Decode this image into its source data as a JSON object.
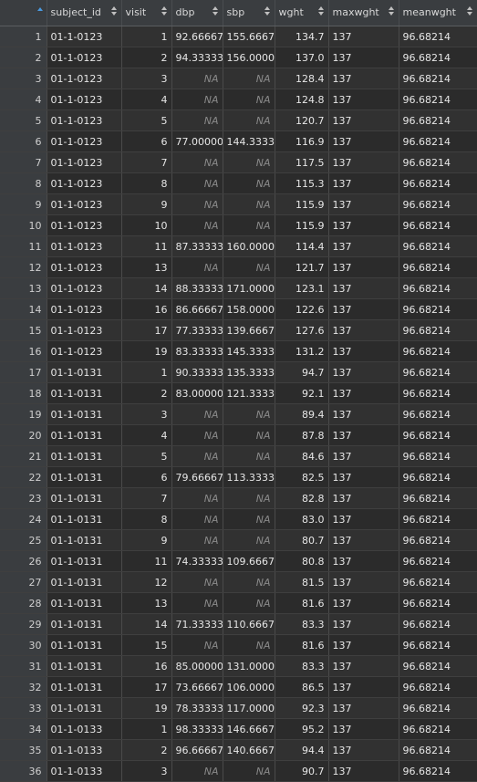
{
  "colors": {
    "background": "#2b2b2b",
    "header_bg": "#3a3d40",
    "text": "#e6e6e6",
    "na_text": "#8a8a8a",
    "sort_active": "#4a9ae0"
  },
  "columns": [
    {
      "key": "index",
      "label": ""
    },
    {
      "key": "subject_id",
      "label": "subject_id"
    },
    {
      "key": "visit",
      "label": "visit"
    },
    {
      "key": "dbp",
      "label": "dbp"
    },
    {
      "key": "sbp",
      "label": "sbp"
    },
    {
      "key": "wght",
      "label": "wght"
    },
    {
      "key": "maxwght",
      "label": "maxwght"
    },
    {
      "key": "meanwght",
      "label": "meanwght"
    }
  ],
  "na_label": "NA",
  "rows": [
    {
      "index": "1",
      "subject_id": "01-1-0123",
      "visit": "1",
      "dbp": "92.66667",
      "sbp": "155.6667",
      "wght": "134.7",
      "maxwght": "137",
      "meanwght": "96.68214"
    },
    {
      "index": "2",
      "subject_id": "01-1-0123",
      "visit": "2",
      "dbp": "94.33333",
      "sbp": "156.0000",
      "wght": "137.0",
      "maxwght": "137",
      "meanwght": "96.68214"
    },
    {
      "index": "3",
      "subject_id": "01-1-0123",
      "visit": "3",
      "dbp": "NA",
      "sbp": "NA",
      "wght": "128.4",
      "maxwght": "137",
      "meanwght": "96.68214"
    },
    {
      "index": "4",
      "subject_id": "01-1-0123",
      "visit": "4",
      "dbp": "NA",
      "sbp": "NA",
      "wght": "124.8",
      "maxwght": "137",
      "meanwght": "96.68214"
    },
    {
      "index": "5",
      "subject_id": "01-1-0123",
      "visit": "5",
      "dbp": "NA",
      "sbp": "NA",
      "wght": "120.7",
      "maxwght": "137",
      "meanwght": "96.68214"
    },
    {
      "index": "6",
      "subject_id": "01-1-0123",
      "visit": "6",
      "dbp": "77.00000",
      "sbp": "144.3333",
      "wght": "116.9",
      "maxwght": "137",
      "meanwght": "96.68214"
    },
    {
      "index": "7",
      "subject_id": "01-1-0123",
      "visit": "7",
      "dbp": "NA",
      "sbp": "NA",
      "wght": "117.5",
      "maxwght": "137",
      "meanwght": "96.68214"
    },
    {
      "index": "8",
      "subject_id": "01-1-0123",
      "visit": "8",
      "dbp": "NA",
      "sbp": "NA",
      "wght": "115.3",
      "maxwght": "137",
      "meanwght": "96.68214"
    },
    {
      "index": "9",
      "subject_id": "01-1-0123",
      "visit": "9",
      "dbp": "NA",
      "sbp": "NA",
      "wght": "115.9",
      "maxwght": "137",
      "meanwght": "96.68214"
    },
    {
      "index": "10",
      "subject_id": "01-1-0123",
      "visit": "10",
      "dbp": "NA",
      "sbp": "NA",
      "wght": "115.9",
      "maxwght": "137",
      "meanwght": "96.68214"
    },
    {
      "index": "11",
      "subject_id": "01-1-0123",
      "visit": "11",
      "dbp": "87.33333",
      "sbp": "160.0000",
      "wght": "114.4",
      "maxwght": "137",
      "meanwght": "96.68214"
    },
    {
      "index": "12",
      "subject_id": "01-1-0123",
      "visit": "13",
      "dbp": "NA",
      "sbp": "NA",
      "wght": "121.7",
      "maxwght": "137",
      "meanwght": "96.68214"
    },
    {
      "index": "13",
      "subject_id": "01-1-0123",
      "visit": "14",
      "dbp": "88.33333",
      "sbp": "171.0000",
      "wght": "123.1",
      "maxwght": "137",
      "meanwght": "96.68214"
    },
    {
      "index": "14",
      "subject_id": "01-1-0123",
      "visit": "16",
      "dbp": "86.66667",
      "sbp": "158.0000",
      "wght": "122.6",
      "maxwght": "137",
      "meanwght": "96.68214"
    },
    {
      "index": "15",
      "subject_id": "01-1-0123",
      "visit": "17",
      "dbp": "77.33333",
      "sbp": "139.6667",
      "wght": "127.6",
      "maxwght": "137",
      "meanwght": "96.68214"
    },
    {
      "index": "16",
      "subject_id": "01-1-0123",
      "visit": "19",
      "dbp": "83.33333",
      "sbp": "145.3333",
      "wght": "131.2",
      "maxwght": "137",
      "meanwght": "96.68214"
    },
    {
      "index": "17",
      "subject_id": "01-1-0131",
      "visit": "1",
      "dbp": "90.33333",
      "sbp": "135.3333",
      "wght": "94.7",
      "maxwght": "137",
      "meanwght": "96.68214"
    },
    {
      "index": "18",
      "subject_id": "01-1-0131",
      "visit": "2",
      "dbp": "83.00000",
      "sbp": "121.3333",
      "wght": "92.1",
      "maxwght": "137",
      "meanwght": "96.68214"
    },
    {
      "index": "19",
      "subject_id": "01-1-0131",
      "visit": "3",
      "dbp": "NA",
      "sbp": "NA",
      "wght": "89.4",
      "maxwght": "137",
      "meanwght": "96.68214"
    },
    {
      "index": "20",
      "subject_id": "01-1-0131",
      "visit": "4",
      "dbp": "NA",
      "sbp": "NA",
      "wght": "87.8",
      "maxwght": "137",
      "meanwght": "96.68214"
    },
    {
      "index": "21",
      "subject_id": "01-1-0131",
      "visit": "5",
      "dbp": "NA",
      "sbp": "NA",
      "wght": "84.6",
      "maxwght": "137",
      "meanwght": "96.68214"
    },
    {
      "index": "22",
      "subject_id": "01-1-0131",
      "visit": "6",
      "dbp": "79.66667",
      "sbp": "113.3333",
      "wght": "82.5",
      "maxwght": "137",
      "meanwght": "96.68214"
    },
    {
      "index": "23",
      "subject_id": "01-1-0131",
      "visit": "7",
      "dbp": "NA",
      "sbp": "NA",
      "wght": "82.8",
      "maxwght": "137",
      "meanwght": "96.68214"
    },
    {
      "index": "24",
      "subject_id": "01-1-0131",
      "visit": "8",
      "dbp": "NA",
      "sbp": "NA",
      "wght": "83.0",
      "maxwght": "137",
      "meanwght": "96.68214"
    },
    {
      "index": "25",
      "subject_id": "01-1-0131",
      "visit": "9",
      "dbp": "NA",
      "sbp": "NA",
      "wght": "80.7",
      "maxwght": "137",
      "meanwght": "96.68214"
    },
    {
      "index": "26",
      "subject_id": "01-1-0131",
      "visit": "11",
      "dbp": "74.33333",
      "sbp": "109.6667",
      "wght": "80.8",
      "maxwght": "137",
      "meanwght": "96.68214"
    },
    {
      "index": "27",
      "subject_id": "01-1-0131",
      "visit": "12",
      "dbp": "NA",
      "sbp": "NA",
      "wght": "81.5",
      "maxwght": "137",
      "meanwght": "96.68214"
    },
    {
      "index": "28",
      "subject_id": "01-1-0131",
      "visit": "13",
      "dbp": "NA",
      "sbp": "NA",
      "wght": "81.6",
      "maxwght": "137",
      "meanwght": "96.68214"
    },
    {
      "index": "29",
      "subject_id": "01-1-0131",
      "visit": "14",
      "dbp": "71.33333",
      "sbp": "110.6667",
      "wght": "83.3",
      "maxwght": "137",
      "meanwght": "96.68214"
    },
    {
      "index": "30",
      "subject_id": "01-1-0131",
      "visit": "15",
      "dbp": "NA",
      "sbp": "NA",
      "wght": "81.6",
      "maxwght": "137",
      "meanwght": "96.68214"
    },
    {
      "index": "31",
      "subject_id": "01-1-0131",
      "visit": "16",
      "dbp": "85.00000",
      "sbp": "131.0000",
      "wght": "83.3",
      "maxwght": "137",
      "meanwght": "96.68214"
    },
    {
      "index": "32",
      "subject_id": "01-1-0131",
      "visit": "17",
      "dbp": "73.66667",
      "sbp": "106.0000",
      "wght": "86.5",
      "maxwght": "137",
      "meanwght": "96.68214"
    },
    {
      "index": "33",
      "subject_id": "01-1-0131",
      "visit": "19",
      "dbp": "78.33333",
      "sbp": "117.0000",
      "wght": "92.3",
      "maxwght": "137",
      "meanwght": "96.68214"
    },
    {
      "index": "34",
      "subject_id": "01-1-0133",
      "visit": "1",
      "dbp": "98.33333",
      "sbp": "146.6667",
      "wght": "95.2",
      "maxwght": "137",
      "meanwght": "96.68214"
    },
    {
      "index": "35",
      "subject_id": "01-1-0133",
      "visit": "2",
      "dbp": "96.66667",
      "sbp": "140.6667",
      "wght": "94.4",
      "maxwght": "137",
      "meanwght": "96.68214"
    },
    {
      "index": "36",
      "subject_id": "01-1-0133",
      "visit": "3",
      "dbp": "NA",
      "sbp": "NA",
      "wght": "90.7",
      "maxwght": "137",
      "meanwght": "96.68214"
    }
  ]
}
